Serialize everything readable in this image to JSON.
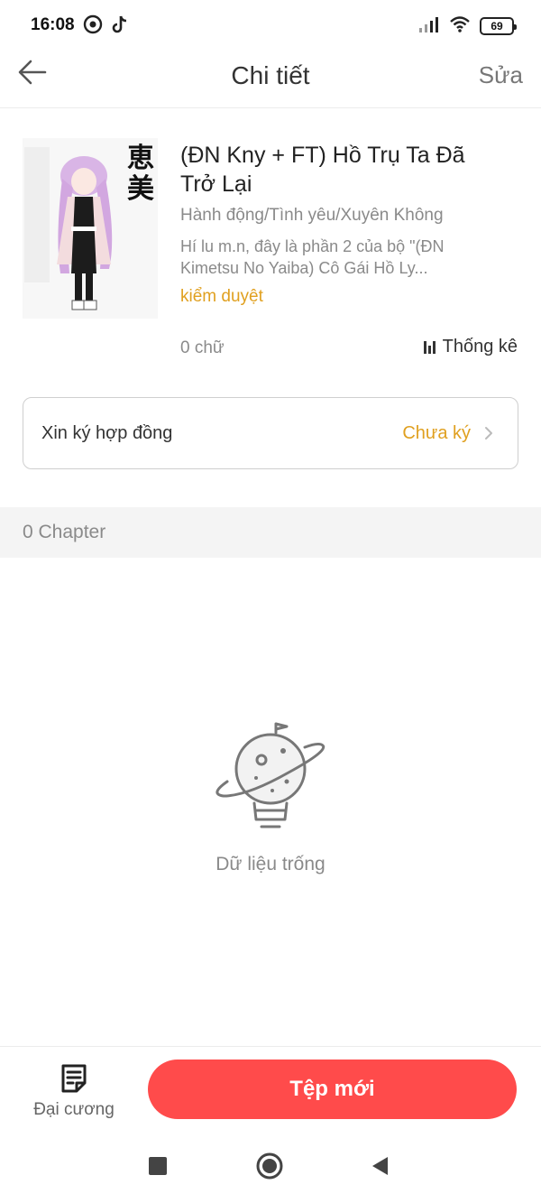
{
  "status_bar": {
    "time": "16:08",
    "battery": "69",
    "icons": [
      "camera-app-icon",
      "tiktok-icon",
      "signal-icon",
      "wifi-icon",
      "battery-icon"
    ]
  },
  "header": {
    "title": "Chi tiết",
    "edit_label": "Sửa",
    "back_icon": "back-arrow-icon"
  },
  "book": {
    "title": "(ĐN Kny + FT) Hồ Trụ Ta Đã Trở Lại",
    "genre": "Hành động/Tình yêu/Xuyên Không",
    "description": "Hí lu m.n, đây là phần 2 của bộ \"(ĐN Kimetsu No Yaiba) Cô Gái Hồ Ly...",
    "status": "kiểm duyệt",
    "word_count": "0 chữ",
    "stats_label": "Thống kê",
    "cover_text": "恵美"
  },
  "contract": {
    "label": "Xin ký hợp đồng",
    "status": "Chưa ký"
  },
  "chapters": {
    "count_label": "0 Chapter"
  },
  "empty_state": {
    "text": "Dữ liệu trống"
  },
  "toolbar": {
    "outline_label": "Đại cương",
    "new_file_label": "Tệp mới"
  },
  "colors": {
    "accent": "#ff4b4b",
    "status_yellow": "#e0a020",
    "muted_text": "#8a8a8a"
  }
}
